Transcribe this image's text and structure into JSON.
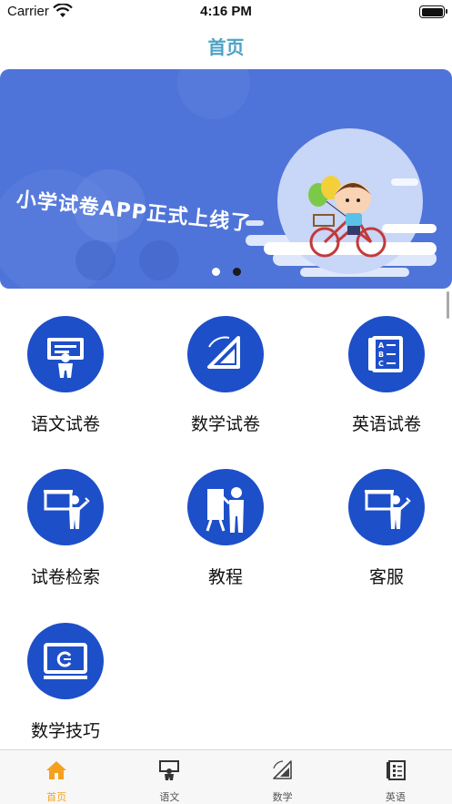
{
  "status_bar": {
    "carrier": "Carrier",
    "time": "4:16 PM"
  },
  "nav": {
    "title": "首页"
  },
  "banner": {
    "headline": "小学试卷APP正式上线了",
    "page_count": 2,
    "active_page": 2
  },
  "grid": {
    "items": [
      {
        "label": "语文试卷",
        "icon": "teacher-board-icon"
      },
      {
        "label": "数学试卷",
        "icon": "set-square-icon"
      },
      {
        "label": "英语试卷",
        "icon": "abc-book-icon"
      },
      {
        "label": "试卷检索",
        "icon": "teacher-pointing-icon"
      },
      {
        "label": "教程",
        "icon": "presentation-easel-icon"
      },
      {
        "label": "客服",
        "icon": "teacher-pointing-icon"
      },
      {
        "label": "数学技巧",
        "icon": "computer-monitor-icon"
      }
    ]
  },
  "tab_bar": {
    "tabs": [
      {
        "label": "首页",
        "icon": "home-icon",
        "active": true
      },
      {
        "label": "语文",
        "icon": "teacher-board-icon",
        "active": false
      },
      {
        "label": "数学",
        "icon": "set-square-icon",
        "active": false
      },
      {
        "label": "英语",
        "icon": "abc-book-icon",
        "active": false
      }
    ]
  },
  "colors": {
    "accent": "#4ba3c4",
    "icon_bg": "#1d4fc9",
    "banner_bg": "#4f74d9",
    "tab_active": "#f4a21d"
  }
}
